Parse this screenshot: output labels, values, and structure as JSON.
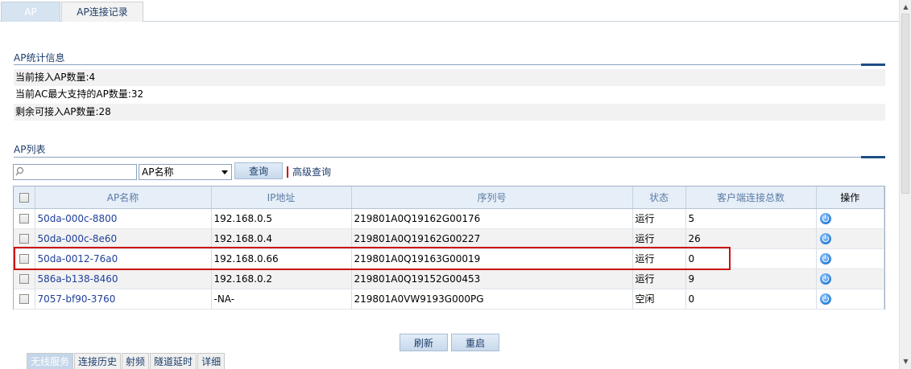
{
  "tabs": [
    {
      "label": "AP",
      "active": true
    },
    {
      "label": "AP连接记录",
      "active": false
    }
  ],
  "stats": {
    "title": "AP统计信息",
    "rows": [
      "当前接入AP数量:4",
      "当前AC最大支持的AP数量:32",
      "剩余可接入AP数量:28"
    ]
  },
  "ap_list": {
    "title": "AP列表",
    "search": {
      "value": "",
      "placeholder": ""
    },
    "select_value": "AP名称",
    "query_label": "查询",
    "advanced_label": "高级查询",
    "columns": [
      "AP名称",
      "IP地址",
      "序列号",
      "状态",
      "客户端连接总数",
      "操作"
    ],
    "rows": [
      {
        "name": "50da-000c-8800",
        "ip": "192.168.0.5",
        "serial": "219801A0Q19162G00176",
        "status": "运行",
        "clients": "5"
      },
      {
        "name": "50da-000c-8e60",
        "ip": "192.168.0.4",
        "serial": "219801A0Q19162G00227",
        "status": "运行",
        "clients": "26"
      },
      {
        "name": "50da-0012-76a0",
        "ip": "192.168.0.66",
        "serial": "219801A0Q19163G00019",
        "status": "运行",
        "clients": "0"
      },
      {
        "name": "586a-b138-8460",
        "ip": "192.168.0.2",
        "serial": "219801A0Q19152G00453",
        "status": "运行",
        "clients": "9"
      },
      {
        "name": "7057-bf90-3760",
        "ip": "-NA-",
        "serial": "219801A0VW9193G000PG",
        "status": "空闲",
        "clients": "0"
      }
    ],
    "action_icon": "power-icon",
    "highlighted_row": 2
  },
  "buttons": {
    "refresh": "刷新",
    "reboot": "重启"
  },
  "bottom_tabs": [
    "无线服务",
    "连接历史",
    "射频",
    "隧道延时",
    "详细"
  ],
  "colors": {
    "accent": "#1f4d86",
    "link": "#1f3f9a",
    "highlight": "#cc1111"
  }
}
